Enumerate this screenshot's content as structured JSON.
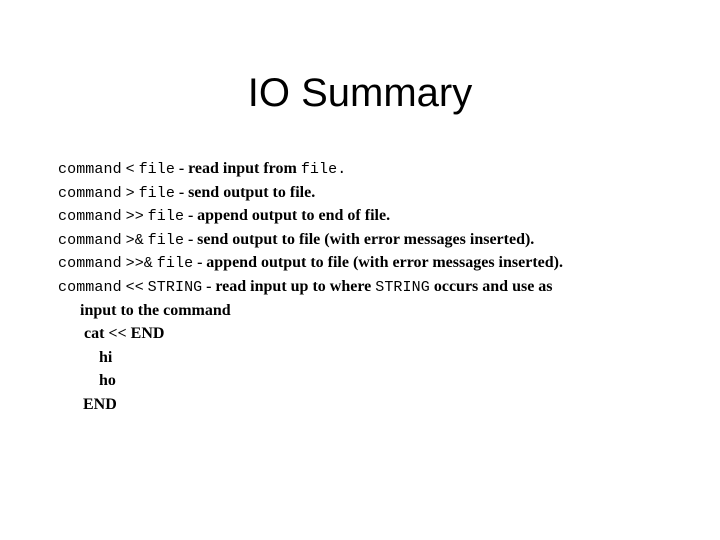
{
  "slide": {
    "title": "IO Summary",
    "background_color": "#ffffff",
    "text_color": "#000000"
  },
  "redirection_lines": [
    {
      "command_token": "command",
      "operator": "<",
      "operand": "file",
      "separator": "-",
      "description_before": "read input from ",
      "description_code": "file.",
      "description_after": "",
      "description_code_is_mono": true
    },
    {
      "command_token": "command",
      "operator": ">",
      "operand": "file",
      "separator": "-",
      "description_before": "send output to file.",
      "description_code": "",
      "description_after": "",
      "description_code_is_mono": false
    },
    {
      "command_token": "command",
      "operator": ">>",
      "operand": "file",
      "separator": "-",
      "description_before": "append output to end of file.",
      "description_code": "",
      "description_after": "",
      "description_code_is_mono": false
    },
    {
      "command_token": "command",
      "operator": ">&",
      "operand": "file",
      "separator": "-",
      "description_before": "send output to file (with error messages inserted).",
      "description_code": "",
      "description_after": "",
      "description_code_is_mono": false
    },
    {
      "command_token": "command",
      "operator": ">>&",
      "operand": "file",
      "separator": "-",
      "description_before": "append output to file (with error messages inserted).",
      "description_code": "",
      "description_after": "",
      "description_code_is_mono": false
    },
    {
      "command_token": "command",
      "operator": "<<",
      "operand": "STRING",
      "separator": "-",
      "description_before": "read input up to where ",
      "description_code": "STRING",
      "description_after": " occurs and use as",
      "description_code_is_mono": true
    }
  ],
  "continuation_lines": [
    {
      "text": "input to the command",
      "indent": "ind-1"
    },
    {
      "text": "cat << END",
      "indent": "ind-2"
    },
    {
      "text": "hi",
      "indent": "ind-3"
    },
    {
      "text": "ho",
      "indent": "ind-3"
    },
    {
      "text": "END",
      "indent": "ind-4"
    }
  ]
}
